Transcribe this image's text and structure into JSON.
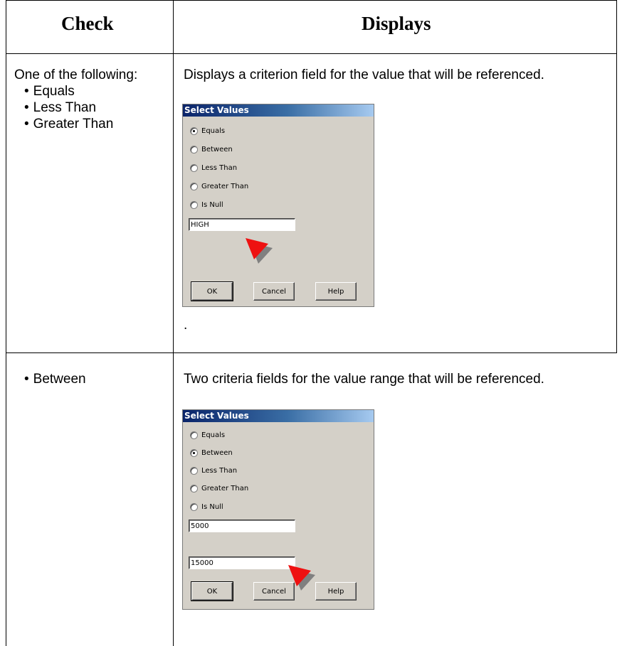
{
  "table": {
    "headers": {
      "check": "Check",
      "displays": "Displays"
    },
    "rows": [
      {
        "check_intro": "One of the following:",
        "check_items": [
          "Equals",
          "Less Than",
          "Greater Than"
        ],
        "description": "Displays a criterion field for the value that will be referenced.",
        "trailing": ".",
        "dialog": {
          "title": "Select Values",
          "options": [
            "Equals",
            "Between",
            "Less Than",
            "Greater Than",
            "Is Null"
          ],
          "selected": "Equals",
          "fields": [
            "HIGH"
          ],
          "buttons": {
            "ok": "OK",
            "cancel": "Cancel",
            "help": "Help"
          }
        }
      },
      {
        "check_items": [
          "Between"
        ],
        "description": "Two criteria fields for the value range that will be referenced.",
        "dialog": {
          "title": "Select Values",
          "options": [
            "Equals",
            "Between",
            "Less Than",
            "Greater Than",
            "Is Null"
          ],
          "selected": "Between",
          "fields": [
            "5000",
            "15000"
          ],
          "buttons": {
            "ok": "OK",
            "cancel": "Cancel",
            "help": "Help"
          }
        }
      }
    ]
  },
  "colors": {
    "cursor_red": "#ee1111",
    "cursor_shadow": "#808080",
    "dialog_bg": "#d4d0c8",
    "title_bar": "#0a246a"
  }
}
